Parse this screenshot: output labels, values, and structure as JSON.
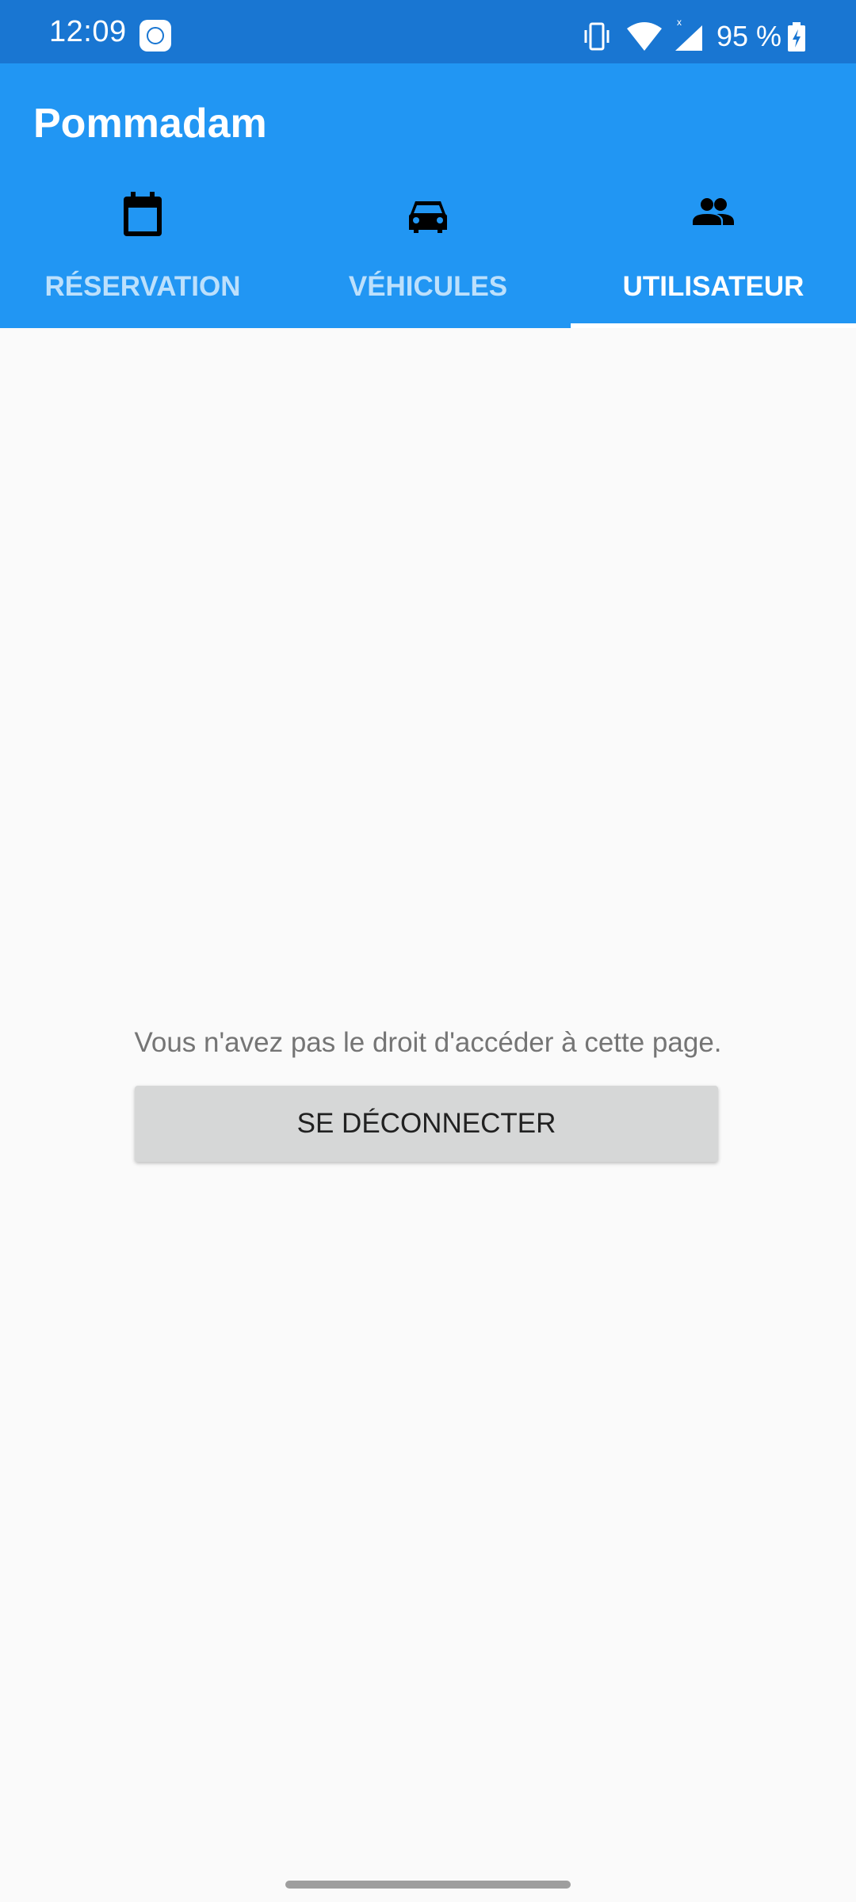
{
  "status_bar": {
    "time": "12:09",
    "battery_percent": "95 %",
    "icons": [
      "notification-app-icon",
      "vibrate-icon",
      "wifi-icon",
      "signal-icon",
      "battery-charging-icon"
    ]
  },
  "app_bar": {
    "title": "Pommadam",
    "color": "#2196f3"
  },
  "tabs": [
    {
      "label": "RÉSERVATION",
      "icon": "calendar-icon",
      "selected": false
    },
    {
      "label": "VÉHICULES",
      "icon": "car-icon",
      "selected": false
    },
    {
      "label": "UTILISATEUR",
      "icon": "users-icon",
      "selected": true
    }
  ],
  "content": {
    "message": "Vous n'avez pas le droit d'accéder à cette page.",
    "logout_label": "SE DÉCONNECTER"
  }
}
